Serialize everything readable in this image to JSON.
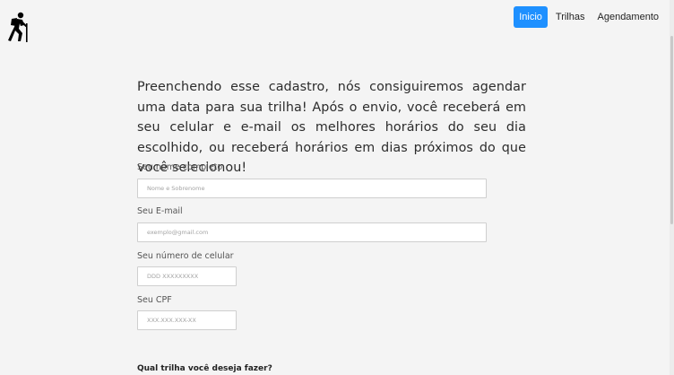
{
  "header": {
    "logo_icon": "hiker-icon",
    "nav": [
      {
        "label": "Inicio",
        "active": true
      },
      {
        "label": "Trilhas",
        "active": false
      },
      {
        "label": "Agendamento",
        "active": false
      }
    ]
  },
  "intro_text": "Preenchendo esse cadastro, nós consiguiremos agendar uma data para sua trilha! Após o envio, você receberá em seu celular e e-mail os melhores horários do seu dia escolhido, ou receberá horários em dias próximos do que você selecionou!",
  "form": {
    "name": {
      "label": "Seu nome completo",
      "placeholder": "Nome e Sobrenome",
      "value": ""
    },
    "email": {
      "label": "Seu E-mail",
      "placeholder": "exemplo@gmail.com",
      "value": ""
    },
    "phone": {
      "label": "Seu número de celular",
      "placeholder": "DDD XXXXXXXXX",
      "value": ""
    },
    "cpf": {
      "label": "Seu CPF",
      "placeholder": "XXX.XXX.XXX-XX",
      "value": ""
    },
    "trail_question": "Qual trilha você deseja fazer?"
  },
  "colors": {
    "accent": "#1e90ff",
    "background": "#f4f4f4"
  }
}
